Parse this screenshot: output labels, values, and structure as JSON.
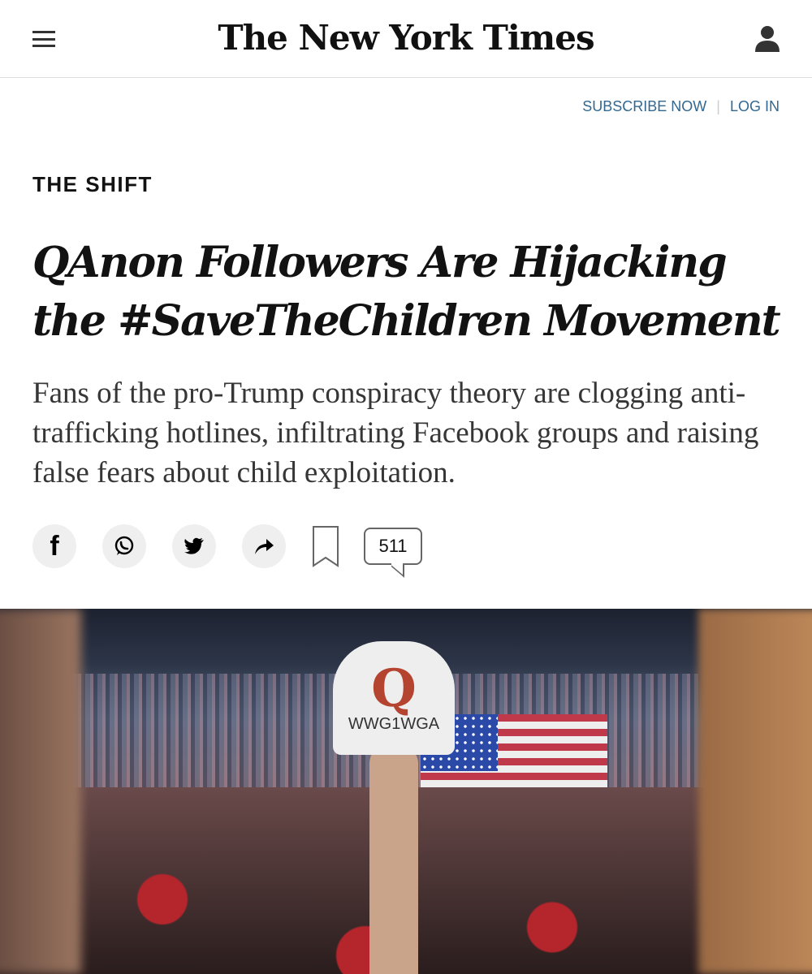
{
  "header": {
    "logo": "The New York Times"
  },
  "nav": {
    "subscribe": "SUBSCRIBE NOW",
    "separator": "|",
    "login": "LOG IN"
  },
  "article": {
    "kicker": "THE SHIFT",
    "headline": "QAnon Followers Are Hijacking the #SaveTheChildren Movement",
    "summary": "Fans of the pro-Trump conspiracy theory are clogging anti-trafficking hotlines, infiltrating Facebook groups and raising false fears about child exploitation.",
    "comment_count": "511"
  },
  "photo": {
    "hat_letter": "Q",
    "hat_text": "WWG1WGA"
  }
}
